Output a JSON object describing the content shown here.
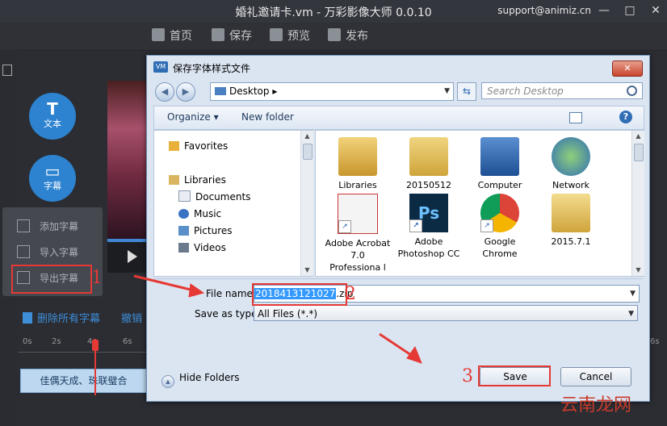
{
  "app": {
    "title": "婚礼邀请卡.vm - 万彩影像大师 0.0.10",
    "support_email": "support@animiz.cn",
    "window_buttons": [
      "—",
      "□",
      "✕"
    ],
    "toolbar": {
      "home": "首页",
      "save": "保存",
      "preview": "预览",
      "publish": "发布"
    },
    "left_buttons": {
      "text": {
        "glyph": "T",
        "label": "文本"
      },
      "subtitle": {
        "glyph": "▭",
        "label": "字幕"
      }
    },
    "subtitle_menu": {
      "add": "添加字幕",
      "import": "导入字幕",
      "export": "导出字幕"
    },
    "delete_all": "删除所有字幕",
    "undo": "撤销",
    "ruler_ticks": [
      "0s",
      "2s",
      "4s",
      "6s"
    ],
    "ruler_tick_right": "6s",
    "clip_text": "佳偶天成、珠联璧合"
  },
  "dialog": {
    "logo": "VM",
    "title": "保存字体样式文件",
    "close_glyph": "✕",
    "address": {
      "location": "Desktop",
      "sep": "▸"
    },
    "search_placeholder": "Search Desktop",
    "commands": {
      "organize": "Organize ▾",
      "new_folder": "New folder"
    },
    "help_glyph": "?",
    "nav": {
      "favorites": "Favorites",
      "libraries": "Libraries",
      "items": [
        "Documents",
        "Music",
        "Pictures",
        "Videos"
      ]
    },
    "files": [
      {
        "name": "Libraries",
        "icon": "libraries-folder-icon"
      },
      {
        "name": "20150512",
        "icon": "user-folder-icon"
      },
      {
        "name": "Computer",
        "icon": "computer-icon"
      },
      {
        "name": "Network",
        "icon": "network-icon"
      },
      {
        "name": "Adobe Acrobat 7.0 Professiona l",
        "icon": "acrobat-icon"
      },
      {
        "name": "Adobe Photoshop CC",
        "icon": "photoshop-icon"
      },
      {
        "name": "Google Chrome",
        "icon": "chrome-icon"
      },
      {
        "name": "2015.7.1",
        "icon": "folder-icon"
      }
    ],
    "file_name_label": "File name:",
    "file_name_selected": "2018413121027",
    "file_name_ext": ".zip",
    "save_type_label": "Save as type:",
    "save_type_value": "All Files (*.*)",
    "hide_folders": "Hide Folders",
    "save_button": "Save",
    "cancel_button": "Cancel"
  },
  "annotations": {
    "n1": "1",
    "n2": "2",
    "n3": "3"
  },
  "watermark": "云南龙网",
  "colors": {
    "accent": "#2d83d0",
    "annotation": "#e53935",
    "selection": "#3399ff"
  }
}
